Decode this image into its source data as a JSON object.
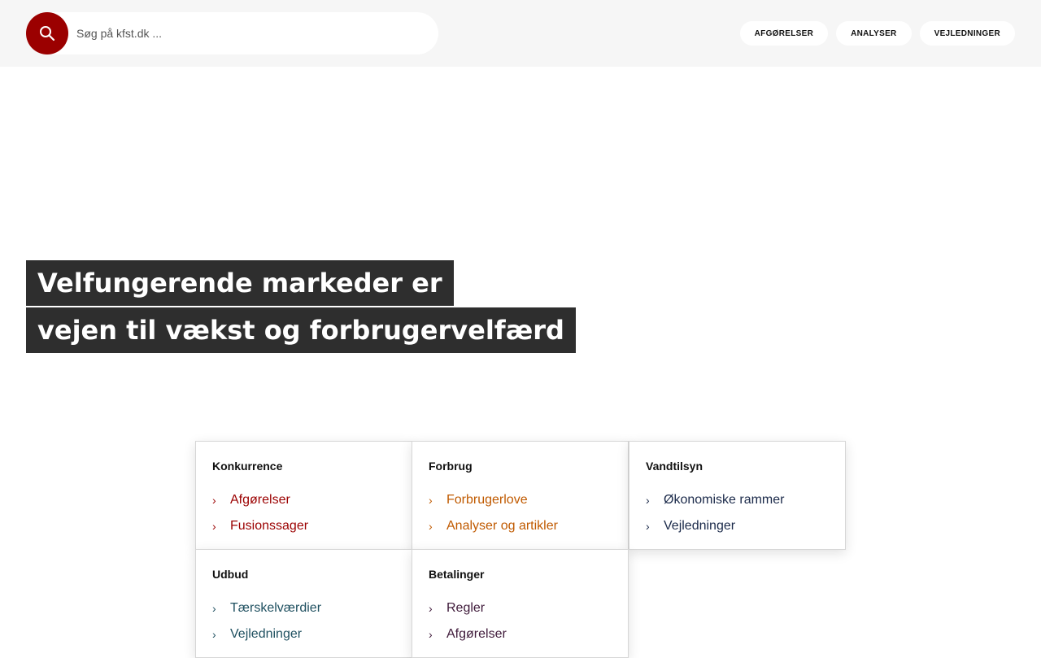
{
  "search": {
    "placeholder": "Søg på kfst.dk ..."
  },
  "nav": {
    "items": [
      "AFGØRELSER",
      "ANALYSER",
      "VEJLEDNINGER"
    ]
  },
  "hero": {
    "line1": "Velfungerende markeder er",
    "line2": "vejen til vækst og forbrugervelfærd"
  },
  "cards": [
    {
      "title": "Konkurrence",
      "color": "#9b0000",
      "links": [
        "Afgørelser",
        "Fusionssager"
      ]
    },
    {
      "title": "Forbrug",
      "color": "#c05a00",
      "links": [
        "Forbrugerlove",
        "Analyser og artikler"
      ]
    },
    {
      "title": "Vandtilsyn",
      "color": "#1b2a4a",
      "links": [
        "Økonomiske rammer",
        "Vejledninger"
      ]
    },
    {
      "title": "Udbud",
      "color": "#1f5060",
      "links": [
        "Tærskelværdier",
        "Vejledninger"
      ]
    },
    {
      "title": "Betalinger",
      "color": "#3f1a3a",
      "links": [
        "Regler",
        "Afgørelser"
      ]
    }
  ],
  "icons": {
    "search": "search-icon",
    "chevron": "chevron-right-icon"
  },
  "colors": {
    "brand": "#9b0000",
    "header_bg": "#f6f6f6",
    "hero_bg": "#2e2e2e"
  }
}
